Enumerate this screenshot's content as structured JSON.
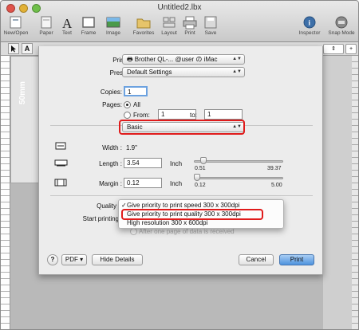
{
  "window": {
    "title": "Untitled2.lbx"
  },
  "toolbar": [
    {
      "label": "New/Open",
      "icon": "new-open-icon"
    },
    {
      "label": "Paper",
      "icon": "paper-icon"
    },
    {
      "label": "Text",
      "icon": "text-icon"
    },
    {
      "label": "Frame",
      "icon": "frame-icon"
    },
    {
      "label": "Image",
      "icon": "image-icon"
    },
    {
      "label": "Favorites",
      "icon": "favorites-icon"
    },
    {
      "label": "Layout",
      "icon": "layout-icon"
    },
    {
      "label": "Print",
      "icon": "print-icon"
    },
    {
      "label": "Save",
      "icon": "save-icon"
    },
    {
      "label": "Inspector",
      "icon": "inspector-icon"
    },
    {
      "label": "Snap Mode",
      "icon": "snap-mode-icon"
    }
  ],
  "toolstrip": {
    "text_tool": "A"
  },
  "label_area": {
    "size": "50mm"
  },
  "print_dialog": {
    "printer_label": "Printer:",
    "printer_value": "Brother QL-...  @user の iMac",
    "presets_label": "Presets:",
    "presets_value": "Default Settings",
    "copies_label": "Copies:",
    "copies_value": "1",
    "pages_label": "Pages:",
    "pages_all": "All",
    "pages_from": "From:",
    "from_value": "1",
    "to_label": "to:",
    "to_value": "1",
    "panel_value": "Basic",
    "width_label": "Width :",
    "width_value": "1.9\"",
    "length_label": "Length :",
    "length_value": "3.54",
    "length_unit": "Inch",
    "length_min": "0.51",
    "length_max": "39.37",
    "length_slider_fraction": 0.08,
    "margin_label": "Margin :",
    "margin_value": "0.12",
    "margin_unit": "Inch",
    "margin_min": "0.12",
    "margin_max": "5.00",
    "margin_slider_fraction": 0.0,
    "quality_label": "Quality",
    "start_printing_label": "Start printing",
    "behind_text": "After one page of data is received",
    "quality_menu": [
      {
        "label": "Give priority to print speed 300 x 300dpi",
        "checked": true
      },
      {
        "label": "Give priority to print quality 300 x 300dpi",
        "checked": false
      },
      {
        "label": "High resolution 300 x 600dpi",
        "checked": false
      }
    ],
    "help_button": "?",
    "pdf_button": "PDF ▾",
    "hide_details_button": "Hide Details",
    "cancel_button": "Cancel",
    "print_button": "Print"
  },
  "colors": {
    "highlight": "#e01b1b",
    "primary_button": "#4e93de"
  }
}
